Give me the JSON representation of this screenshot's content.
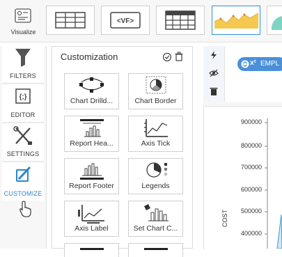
{
  "toolbar": {
    "visualize_label": "Visualize",
    "vf_label": "<VF>"
  },
  "rail": {
    "filters": "FILTERS",
    "editor": "EDITOR",
    "settings": "SETTINGS",
    "customize": "CUSTOMIZE",
    "editor_glyph": "{;}"
  },
  "panel": {
    "title": "Customization",
    "cards": [
      "Chart Drilld...",
      "Chart Border",
      "Report Hea...",
      "Axis Tick",
      "Report Footer",
      "Legends",
      "Axis Label",
      "Set Chart C..."
    ]
  },
  "canvas": {
    "chip_label": "EMPL",
    "chip_glyph": "x²",
    "y_axis_label": "COST",
    "y_ticks": [
      "900000",
      "800000",
      "700000",
      "600000",
      "500000",
      "400000"
    ]
  },
  "colors": {
    "accent": "#2f8fd8",
    "chip": "#4a90d9",
    "area_fill": "#f5c94f"
  }
}
